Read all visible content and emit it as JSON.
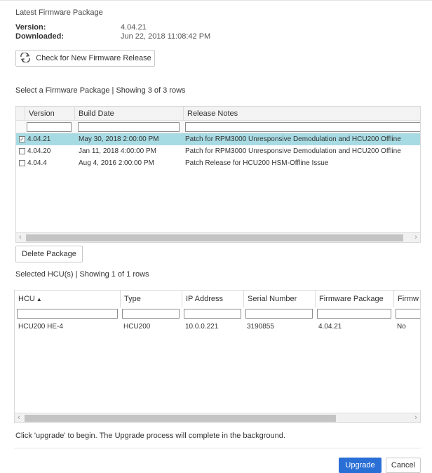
{
  "latest": {
    "title": "Latest Firmware Package",
    "version_label": "Version:",
    "version_value": "4.04.21",
    "downloaded_label": "Downloaded:",
    "downloaded_value": "Jun 22, 2018 11:08:42 PM",
    "check_button": "Check for New Firmware Release"
  },
  "packages": {
    "caption": "Select a Firmware Package | Showing 3 of 3 rows",
    "columns": [
      "Version",
      "Build Date",
      "Release Notes"
    ],
    "rows": [
      {
        "checked": true,
        "selected": true,
        "version": "4.04.21",
        "build_date": "May 30, 2018 2:00:00 PM",
        "notes": "Patch for RPM3000 Unresponsive Demodulation and HCU200 Offline"
      },
      {
        "checked": false,
        "selected": false,
        "version": "4.04.20",
        "build_date": "Jan 11, 2018 4:00:00 PM",
        "notes": "Patch for RPM3000 Unresponsive Demodulation and HCU200 Offline"
      },
      {
        "checked": false,
        "selected": false,
        "version": "4.04.4",
        "build_date": "Aug 4, 2016 2:00:00 PM",
        "notes": "Patch Release for HCU200 HSM-Offline Issue"
      }
    ],
    "check_mark": "✓",
    "scroll_left": "‹",
    "scroll_right": "›",
    "delete_button": "Delete Package"
  },
  "hcus": {
    "caption": "Selected HCU(s) | Showing 1 of 1 rows",
    "columns": [
      "HCU",
      "Type",
      "IP Address",
      "Serial Number",
      "Firmware Package",
      "Firmw"
    ],
    "sort_glyph": "▲",
    "rows": [
      {
        "hcu": "HCU200 HE-4",
        "type": "HCU200",
        "ip": "10.0.0.221",
        "serial": "3190855",
        "firmware": "4.04.21",
        "extra": "No"
      }
    ],
    "scroll_left": "‹",
    "scroll_right": "›"
  },
  "footer": {
    "message": "Click 'upgrade' to begin. The Upgrade process will complete in the background.",
    "upgrade_button": "Upgrade",
    "cancel_button": "Cancel"
  },
  "colors": {
    "selected_row": "#a7dbe3",
    "primary": "#2a6fd6"
  },
  "icons": {
    "refresh": "refresh-icon"
  }
}
